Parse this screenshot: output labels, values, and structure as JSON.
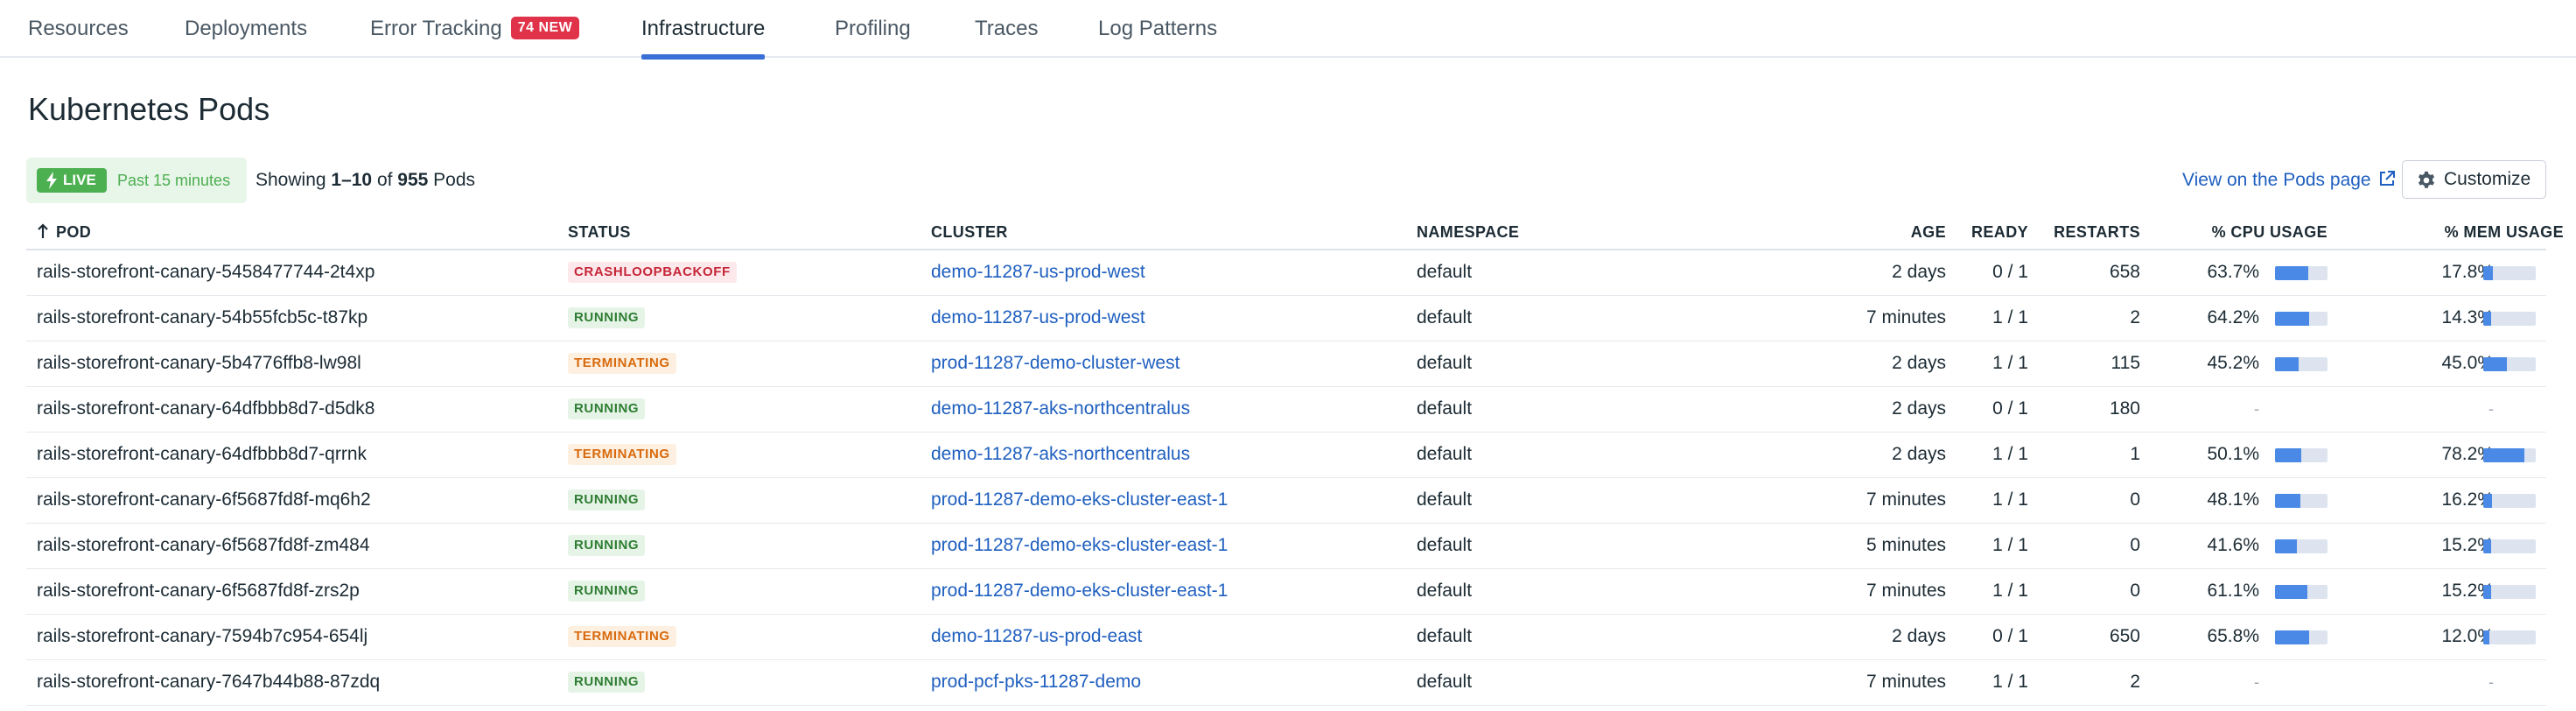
{
  "tabs": [
    {
      "label": "Resources",
      "active": false
    },
    {
      "label": "Deployments",
      "active": false
    },
    {
      "label": "Error Tracking",
      "badge": "74 NEW",
      "active": false
    },
    {
      "label": "Infrastructure",
      "active": true
    },
    {
      "label": "Profiling",
      "active": false
    },
    {
      "label": "Traces",
      "active": false
    },
    {
      "label": "Log Patterns",
      "active": false
    }
  ],
  "page_title": "Kubernetes Pods",
  "live": {
    "label": "LIVE",
    "window": "Past 15 minutes"
  },
  "showing": {
    "prefix": "Showing ",
    "range": "1–10",
    "of": " of ",
    "total": "955",
    "suffix": " Pods"
  },
  "pods_link": "View on the Pods page",
  "customize_label": "Customize",
  "columns": {
    "pod": "POD",
    "status": "STATUS",
    "cluster": "CLUSTER",
    "namespace": "NAMESPACE",
    "age": "AGE",
    "ready": "READY",
    "restarts": "RESTARTS",
    "cpu": "% CPU USAGE",
    "mem": "% MEM USAGE"
  },
  "colors": {
    "accent": "#3a6fd8",
    "link": "#1f5fbf",
    "bar_fill": "#4a8ae6",
    "bar_track": "#dde4ef"
  },
  "rows": [
    {
      "pod": "rails-storefront-canary-5458477744-2t4xp",
      "status": "CRASHLOOPBACKOFF",
      "status_kind": "crash",
      "cluster": "demo-11287-us-prod-west",
      "namespace": "default",
      "age": "2 days",
      "ready": "0 / 1",
      "restarts": "658",
      "cpu": "63.7%",
      "cpu_pct": 63.7,
      "mem": "17.8%",
      "mem_pct": 17.8
    },
    {
      "pod": "rails-storefront-canary-54b55fcb5c-t87kp",
      "status": "RUNNING",
      "status_kind": "run",
      "cluster": "demo-11287-us-prod-west",
      "namespace": "default",
      "age": "7 minutes",
      "ready": "1 / 1",
      "restarts": "2",
      "cpu": "64.2%",
      "cpu_pct": 64.2,
      "mem": "14.3%",
      "mem_pct": 14.3
    },
    {
      "pod": "rails-storefront-canary-5b4776ffb8-lw98l",
      "status": "TERMINATING",
      "status_kind": "term",
      "cluster": "prod-11287-demo-cluster-west",
      "namespace": "default",
      "age": "2 days",
      "ready": "1 / 1",
      "restarts": "115",
      "cpu": "45.2%",
      "cpu_pct": 45.2,
      "mem": "45.0%",
      "mem_pct": 45.0
    },
    {
      "pod": "rails-storefront-canary-64dfbbb8d7-d5dk8",
      "status": "RUNNING",
      "status_kind": "run",
      "cluster": "demo-11287-aks-northcentralus",
      "namespace": "default",
      "age": "2 days",
      "ready": "0 / 1",
      "restarts": "180",
      "cpu": "-",
      "cpu_pct": null,
      "mem": "-",
      "mem_pct": null
    },
    {
      "pod": "rails-storefront-canary-64dfbbb8d7-qrrnk",
      "status": "TERMINATING",
      "status_kind": "term",
      "cluster": "demo-11287-aks-northcentralus",
      "namespace": "default",
      "age": "2 days",
      "ready": "1 / 1",
      "restarts": "1",
      "cpu": "50.1%",
      "cpu_pct": 50.1,
      "mem": "78.2%",
      "mem_pct": 78.2
    },
    {
      "pod": "rails-storefront-canary-6f5687fd8f-mq6h2",
      "status": "RUNNING",
      "status_kind": "run",
      "cluster": "prod-11287-demo-eks-cluster-east-1",
      "namespace": "default",
      "age": "7 minutes",
      "ready": "1 / 1",
      "restarts": "0",
      "cpu": "48.1%",
      "cpu_pct": 48.1,
      "mem": "16.2%",
      "mem_pct": 16.2
    },
    {
      "pod": "rails-storefront-canary-6f5687fd8f-zm484",
      "status": "RUNNING",
      "status_kind": "run",
      "cluster": "prod-11287-demo-eks-cluster-east-1",
      "namespace": "default",
      "age": "5 minutes",
      "ready": "1 / 1",
      "restarts": "0",
      "cpu": "41.6%",
      "cpu_pct": 41.6,
      "mem": "15.2%",
      "mem_pct": 15.2
    },
    {
      "pod": "rails-storefront-canary-6f5687fd8f-zrs2p",
      "status": "RUNNING",
      "status_kind": "run",
      "cluster": "prod-11287-demo-eks-cluster-east-1",
      "namespace": "default",
      "age": "7 minutes",
      "ready": "1 / 1",
      "restarts": "0",
      "cpu": "61.1%",
      "cpu_pct": 61.1,
      "mem": "15.2%",
      "mem_pct": 15.2
    },
    {
      "pod": "rails-storefront-canary-7594b7c954-654lj",
      "status": "TERMINATING",
      "status_kind": "term",
      "cluster": "demo-11287-us-prod-east",
      "namespace": "default",
      "age": "2 days",
      "ready": "0 / 1",
      "restarts": "650",
      "cpu": "65.8%",
      "cpu_pct": 65.8,
      "mem": "12.0%",
      "mem_pct": 12.0
    },
    {
      "pod": "rails-storefront-canary-7647b44b88-87zdq",
      "status": "RUNNING",
      "status_kind": "run",
      "cluster": "prod-pcf-pks-11287-demo",
      "namespace": "default",
      "age": "7 minutes",
      "ready": "1 / 1",
      "restarts": "2",
      "cpu": "-",
      "cpu_pct": null,
      "mem": "-",
      "mem_pct": null
    }
  ]
}
